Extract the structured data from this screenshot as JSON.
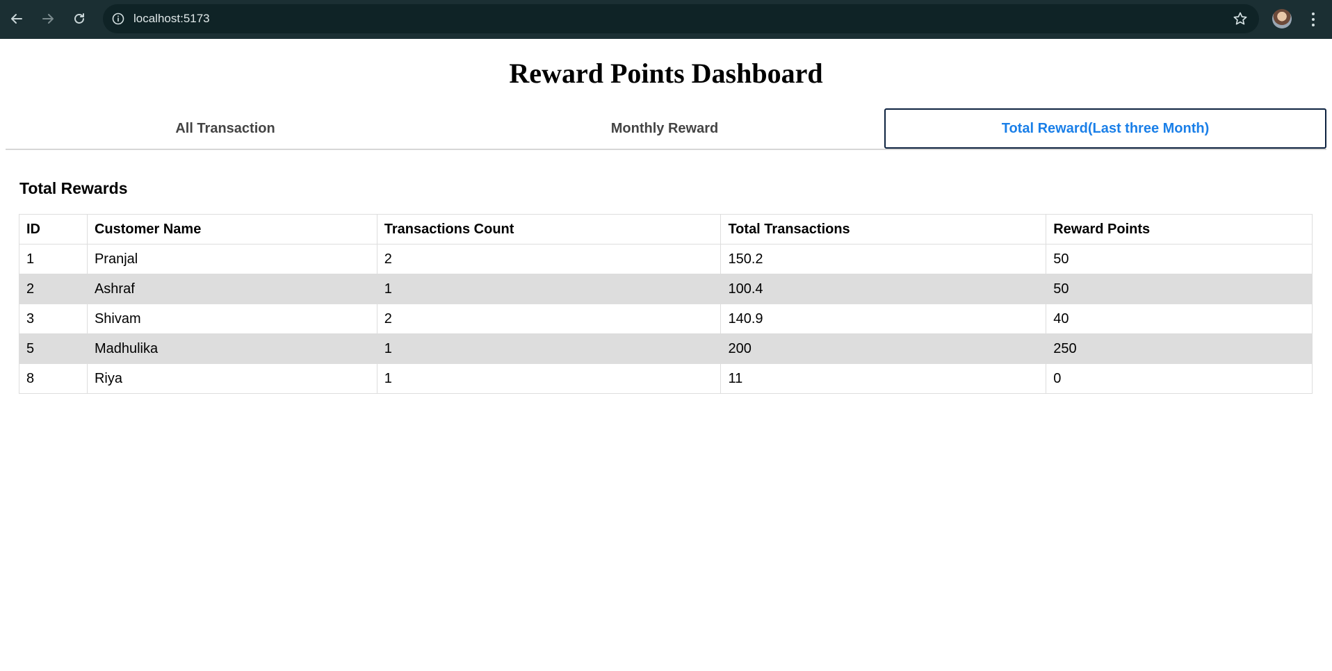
{
  "browser": {
    "url": "localhost:5173",
    "icons": {
      "back": "back-arrow-icon",
      "forward": "forward-arrow-icon",
      "reload": "reload-icon",
      "site_info": "info-icon",
      "bookmark": "star-icon",
      "menu": "kebab-menu-icon"
    }
  },
  "page": {
    "title": "Reward Points Dashboard"
  },
  "tabs": [
    {
      "label": "All Transaction",
      "active": false
    },
    {
      "label": "Monthly Reward",
      "active": false
    },
    {
      "label": "Total Reward(Last three Month)",
      "active": true
    }
  ],
  "section": {
    "title": "Total Rewards"
  },
  "table": {
    "columns": [
      "ID",
      "Customer Name",
      "Transactions Count",
      "Total Transactions",
      "Reward Points"
    ],
    "rows": [
      [
        "1",
        "Pranjal",
        "2",
        "150.2",
        "50"
      ],
      [
        "2",
        "Ashraf",
        "1",
        "100.4",
        "50"
      ],
      [
        "3",
        "Shivam",
        "2",
        "140.9",
        "40"
      ],
      [
        "5",
        "Madhulika",
        "1",
        "200",
        "250"
      ],
      [
        "8",
        "Riya",
        "1",
        "11",
        "0"
      ]
    ]
  },
  "colors": {
    "browser_bar": "#1b2f33",
    "active_tab_text": "#1a7fe8",
    "active_tab_border": "#0d2240",
    "zebra_row": "#dddddd"
  }
}
